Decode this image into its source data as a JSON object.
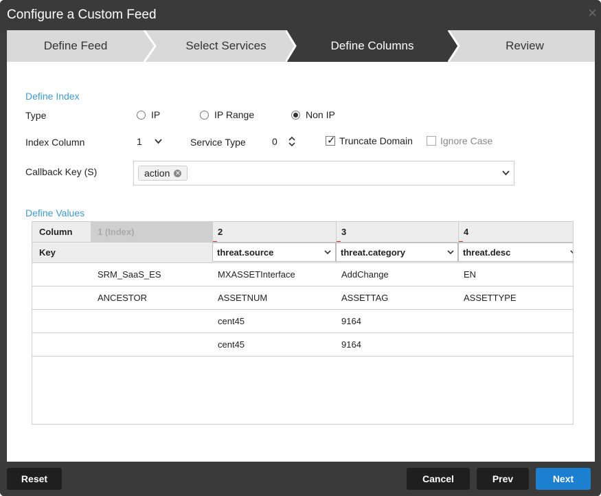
{
  "window": {
    "title": "Configure a Custom Feed",
    "close_glyph": "×"
  },
  "wizard": {
    "steps": [
      {
        "label": "Define Feed",
        "active": false
      },
      {
        "label": "Select Services",
        "active": false
      },
      {
        "label": "Define Columns",
        "active": true
      },
      {
        "label": "Review",
        "active": false
      }
    ]
  },
  "define_index": {
    "section_label": "Define Index",
    "type_label": "Type",
    "type_options": [
      {
        "label": "IP",
        "selected": false
      },
      {
        "label": "IP Range",
        "selected": false
      },
      {
        "label": "Non IP",
        "selected": true
      }
    ],
    "index_column_label": "Index Column",
    "index_column_value": "1",
    "service_type_label": "Service Type",
    "service_type_value": "0",
    "truncate_domain_label": "Truncate Domain",
    "truncate_domain_checked": true,
    "ignore_case_label": "Ignore Case",
    "ignore_case_checked": false,
    "callback_key_label": "Callback Key (S)",
    "callback_tags": [
      "action"
    ]
  },
  "define_values": {
    "section_label": "Define Values",
    "header_row": [
      "Column",
      "1 (Index)",
      "2",
      "3",
      "4"
    ],
    "key_label": "Key",
    "key_selects": [
      "threat.source",
      "threat.category",
      "threat.desc"
    ],
    "rows": [
      [
        "SRM_SaaS_ES",
        "MXASSETInterface",
        "AddChange",
        "EN"
      ],
      [
        "ANCESTOR",
        "ASSETNUM",
        "ASSETTAG",
        "ASSETTYPE"
      ],
      [
        "",
        "cent45",
        "9164",
        ""
      ],
      [
        "",
        "cent45",
        "9164",
        ""
      ]
    ]
  },
  "footer": {
    "reset": "Reset",
    "cancel": "Cancel",
    "prev": "Prev",
    "next": "Next"
  },
  "colors": {
    "accent": "#1c7fcf",
    "section_label": "#3b9ad9",
    "chrome": "#3a3a3a",
    "required_marker": "#d03030"
  },
  "icons": {
    "select_chevron": "chevron-down-icon",
    "stepper": "up-down-stepper-icon",
    "tag_remove": "close-circle-icon"
  }
}
